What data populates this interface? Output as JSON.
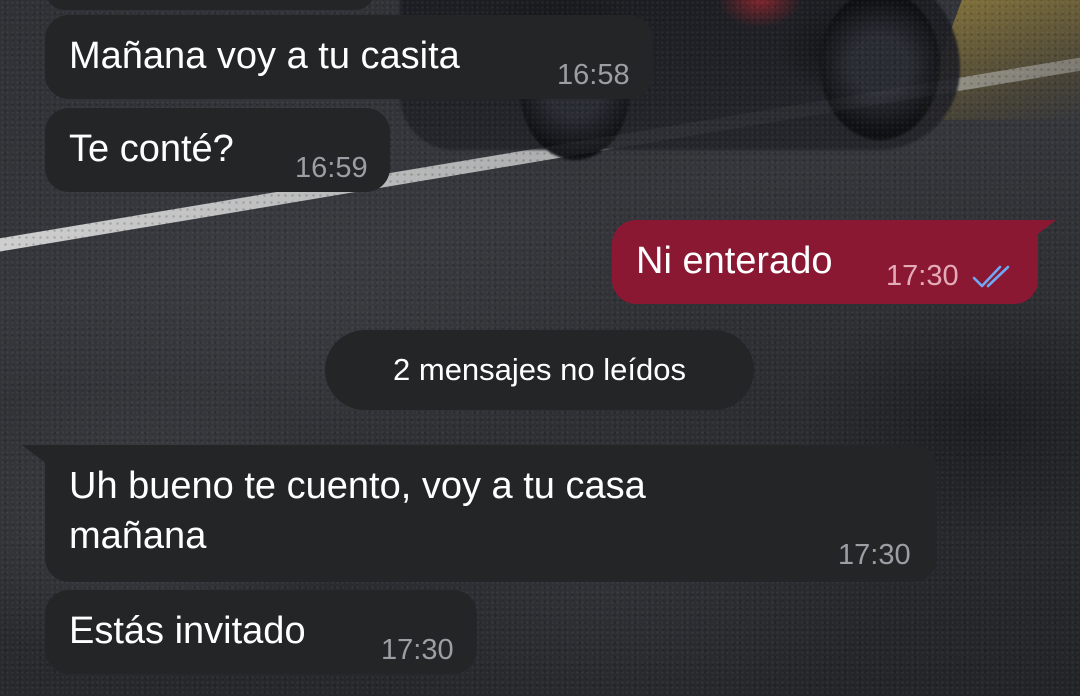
{
  "chat": {
    "messages": [
      {
        "direction": "incoming",
        "text": "Mañana voy a tu casita",
        "time": "16:58"
      },
      {
        "direction": "incoming",
        "text": "Te conté?",
        "time": "16:59"
      },
      {
        "direction": "outgoing",
        "text": "Ni enterado",
        "time": "17:30",
        "status": "read",
        "status_icon": "double-check-icon"
      },
      {
        "direction": "incoming",
        "text": "Uh bueno te cuento, voy a tu casa\nmañana",
        "time": "17:30"
      },
      {
        "direction": "incoming",
        "text": "Estás invitado",
        "time": "17:30"
      }
    ],
    "unread_separator": "2 mensajes no leídos"
  },
  "colors": {
    "incoming_bubble": "#242527",
    "outgoing_bubble": "#8b1833",
    "read_ticks": "#6fa8f5"
  }
}
